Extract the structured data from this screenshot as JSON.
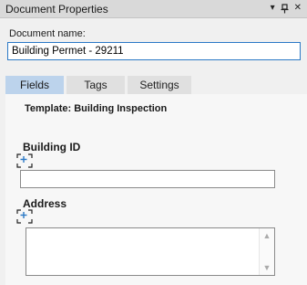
{
  "window": {
    "title": "Document Properties",
    "dropdown_glyph": "▾",
    "pin_icon": "pin-icon",
    "close_glyph": "✕"
  },
  "document": {
    "name_label": "Document name:",
    "name_value": "Building Permet - 29211"
  },
  "tabs": [
    {
      "label": "Fields",
      "active": true
    },
    {
      "label": "Tags",
      "active": false
    },
    {
      "label": "Settings",
      "active": false
    }
  ],
  "fields_panel": {
    "template_label": "Template: Building Inspection",
    "fields": [
      {
        "label": "Building ID",
        "value": "",
        "icon": "region-select-icon"
      },
      {
        "label": "Address",
        "value": "",
        "icon": "region-select-icon"
      }
    ]
  },
  "colors": {
    "active_tab": "#bcd3ec",
    "focus_border": "#2b79c6",
    "title_bar": "#d9d9d9"
  }
}
